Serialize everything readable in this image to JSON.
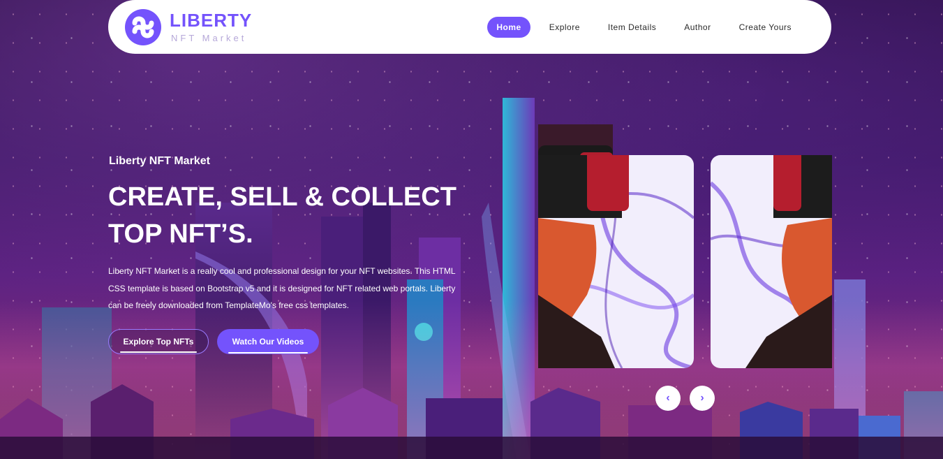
{
  "brand": {
    "name": "LIBERTY",
    "tagline": "NFT Market"
  },
  "nav": {
    "items": [
      {
        "label": "Home",
        "active": true
      },
      {
        "label": "Explore",
        "active": false
      },
      {
        "label": "Item Details",
        "active": false
      },
      {
        "label": "Author",
        "active": false
      },
      {
        "label": "Create Yours",
        "active": false
      }
    ]
  },
  "hero": {
    "eyebrow": "Liberty NFT Market",
    "title_line1": "CREATE, SELL & COLLECT",
    "title_line2": "TOP NFT’S.",
    "description": "Liberty NFT Market is a really cool and professional design for your NFT websites. This HTML CSS template is based on Bootstrap v5 and it is designed for NFT related web portals. Liberty can be freely downloaded from TemplateMo's free css templates.",
    "primary_button": "Explore Top NFTs",
    "secondary_button": "Watch Our Videos"
  },
  "carousel": {
    "prev_icon": "chevron-left-icon",
    "next_icon": "chevron-right-icon",
    "prev_glyph": "‹",
    "next_glyph": "›"
  },
  "colors": {
    "accent": "#7453fc",
    "header_bg": "#ffffff",
    "text_light": "#ffffff"
  }
}
